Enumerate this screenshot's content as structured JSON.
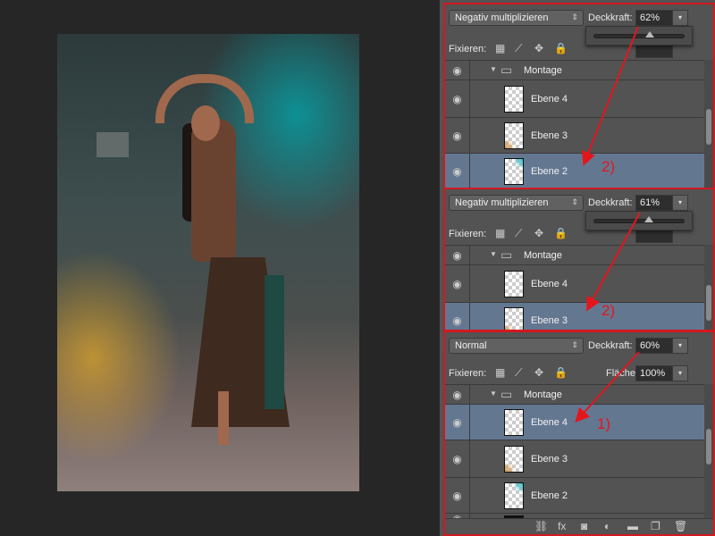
{
  "panels": [
    {
      "blend_mode": "Negativ multiplizieren",
      "opacity_label": "Deckkraft:",
      "opacity": "62%",
      "lock_label": "Fixieren:",
      "slider_popup": true,
      "slider_value": 62,
      "annotation": "2)",
      "layers": [
        {
          "name": "Montage",
          "type": "group"
        },
        {
          "name": "Ebene 4",
          "thumb": "plain"
        },
        {
          "name": "Ebene 3",
          "thumb": "orange"
        },
        {
          "name": "Ebene 2",
          "thumb": "teal",
          "active": true
        }
      ]
    },
    {
      "blend_mode": "Negativ multiplizieren",
      "opacity_label": "Deckkraft:",
      "opacity": "61%",
      "lock_label": "Fixieren:",
      "slider_popup": true,
      "slider_value": 61,
      "annotation": "2)",
      "layers": [
        {
          "name": "Montage",
          "type": "group"
        },
        {
          "name": "Ebene 4",
          "thumb": "plain"
        },
        {
          "name": "Ebene 3",
          "thumb": "orange",
          "active": true
        }
      ]
    },
    {
      "blend_mode": "Normal",
      "opacity_label": "Deckkraft:",
      "opacity": "60%",
      "lock_label": "Fixieren:",
      "fill_label": "Fläche:",
      "fill": "100%",
      "slider_popup": false,
      "annotation": "1)",
      "layers": [
        {
          "name": "Montage",
          "type": "group"
        },
        {
          "name": "Ebene 4",
          "thumb": "plain",
          "active": true
        },
        {
          "name": "Ebene 3",
          "thumb": "orange"
        },
        {
          "name": "Ebene 2",
          "thumb": "teal"
        },
        {
          "name": "",
          "thumb": "dark"
        }
      ],
      "bottom_icons": [
        "link-icon",
        "fx-icon",
        "mask-icon",
        "adjustment-icon",
        "folder-icon",
        "new-layer-icon",
        "trash-icon"
      ]
    }
  ],
  "colors": {
    "annotation": "#e3161e",
    "active_layer": "#647791",
    "panel_bg": "#535353"
  }
}
